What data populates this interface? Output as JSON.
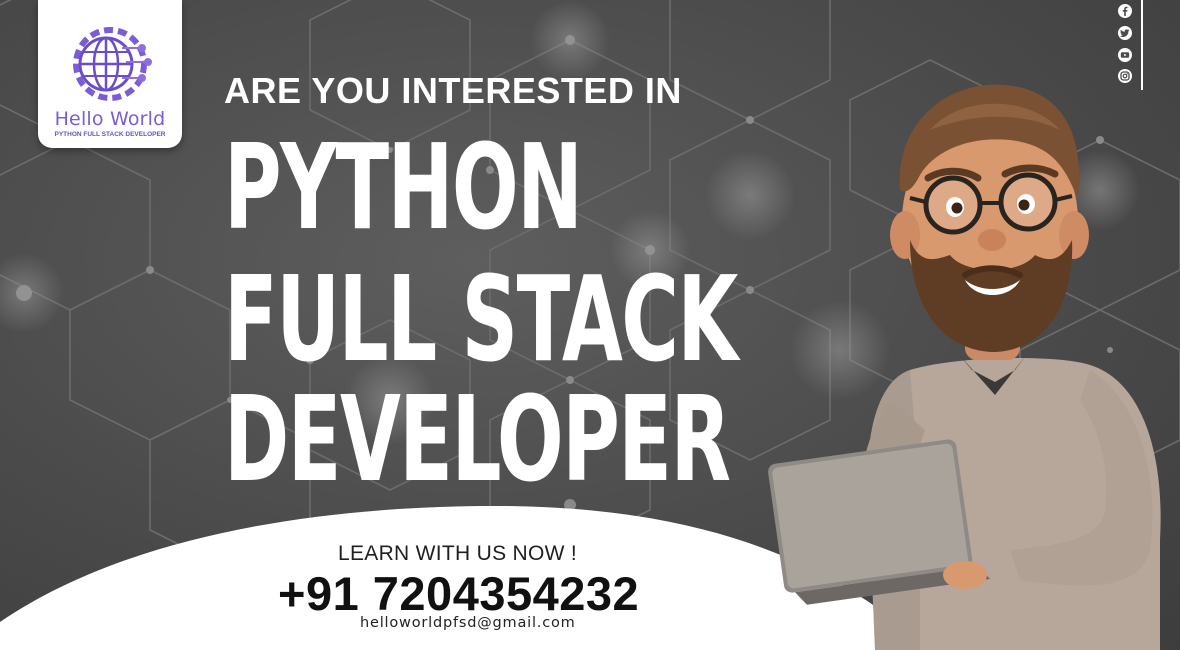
{
  "brand": {
    "name": "Hello World",
    "tagline": "PYTHON FULL STACK DEVELOPER",
    "accent_color": "#7b5cd6"
  },
  "headline": {
    "eyebrow": "ARE YOU INTERESTED IN",
    "line1": "PYTHON",
    "line2": "FULL STACK",
    "line3": "DEVELOPER"
  },
  "cta": {
    "learn": "LEARN WITH US NOW !",
    "phone": "+91 7204354232",
    "email": "helloworldpfsd@gmail.com"
  },
  "social_icons": [
    "facebook-icon",
    "twitter-icon",
    "youtube-icon",
    "instagram-icon"
  ],
  "colors": {
    "background": "#4b4b4b",
    "headline_text": "#ffffff",
    "cta_panel": "#ffffff"
  }
}
